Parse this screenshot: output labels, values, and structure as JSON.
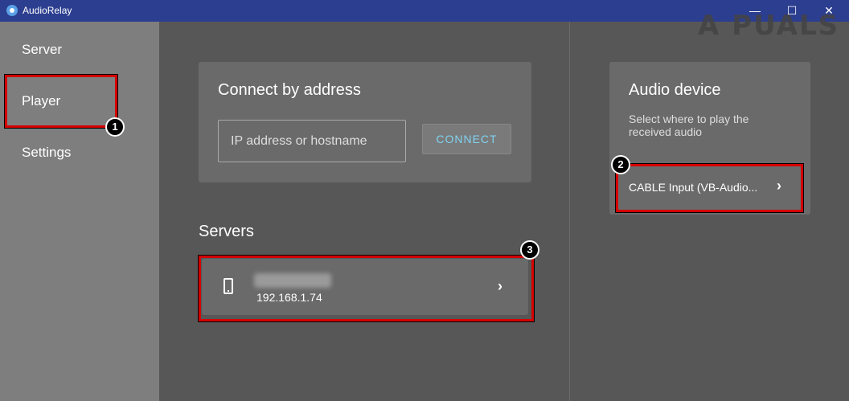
{
  "window": {
    "title": "AudioRelay",
    "minimize": "—",
    "maximize": "☐",
    "close": "✕"
  },
  "watermark": "A  PUALS",
  "sidebar": {
    "items": [
      {
        "label": "Server"
      },
      {
        "label": "Player"
      },
      {
        "label": "Settings"
      }
    ]
  },
  "connect": {
    "title": "Connect by address",
    "placeholder": "IP address or hostname",
    "button": "CONNECT"
  },
  "servers": {
    "title": "Servers",
    "items": [
      {
        "ip": "192.168.1.74"
      }
    ]
  },
  "audio": {
    "title": "Audio device",
    "description": "Select where to play the received audio",
    "device": "CABLE Input (VB-Audio..."
  },
  "annotations": {
    "badges": [
      "1",
      "2",
      "3"
    ]
  },
  "colors": {
    "titlebar": "#2c3e8f",
    "sidebar": "#7e7e7e",
    "card": "#6a6a6a",
    "highlight": "#d40000",
    "connect_text": "#7fd3f0"
  }
}
